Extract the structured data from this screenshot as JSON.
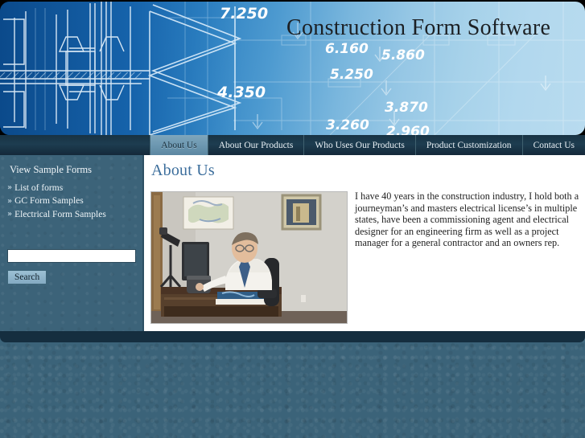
{
  "site": {
    "banner_title": "Construction Form Software",
    "blueprint_numbers": [
      "7.250",
      "6.160",
      "5.860",
      "5.250",
      "4.350",
      "3.870",
      "3.260",
      "2.960"
    ],
    "colors": {
      "page_background": "#3b6379",
      "sidebar_background": "#3c6379",
      "nav_background": "#1a384a",
      "nav_active": "#6d98b1",
      "heading_blue": "#3c6e9c",
      "bottom_band": "#152e3f",
      "banner_blue_dark": "#0d4d8e",
      "banner_blue_light": "#b8dbef"
    }
  },
  "nav": {
    "items": [
      {
        "label": "About Us",
        "active": true
      },
      {
        "label": "About Our Products",
        "active": false
      },
      {
        "label": "Who Uses Our Products",
        "active": false
      },
      {
        "label": "Product Customization",
        "active": false
      },
      {
        "label": "Contact Us",
        "active": false
      }
    ]
  },
  "sidebar": {
    "title": "View Sample Forms",
    "bullet": "»",
    "links": [
      {
        "label": "List of forms"
      },
      {
        "label": "GC Form Samples"
      },
      {
        "label": "Electrical Form Samples"
      }
    ],
    "search": {
      "value": "",
      "placeholder": "",
      "button_label": "Search"
    }
  },
  "main": {
    "title": "About Us",
    "photo_alt": "man working at office desk with computer",
    "paragraph": "I have 40 years in the construction industry, I hold both a journeyman’s and masters electrical license’s in multiple states, have been a commissioning agent and electrical designer for an engineering firm as well as a project manager for a general contractor and an owners rep."
  }
}
